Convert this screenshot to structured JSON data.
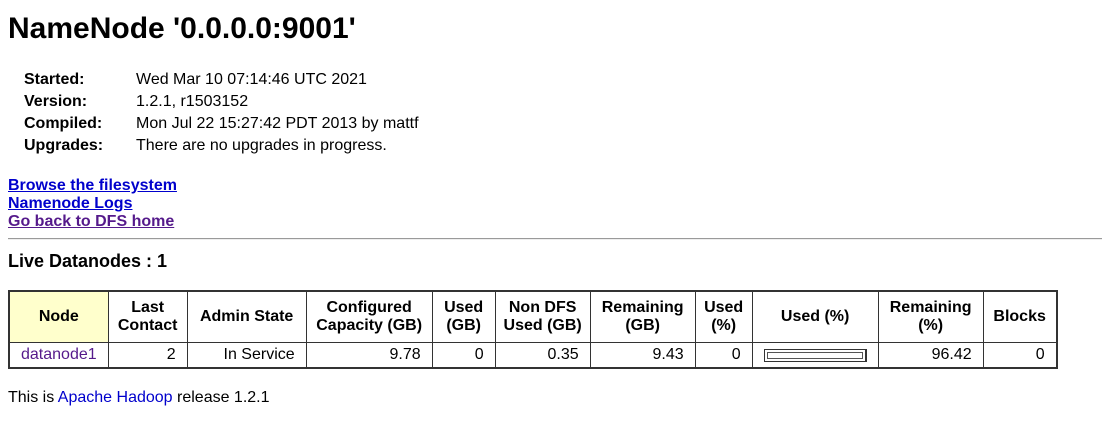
{
  "page": {
    "title": "NameNode '0.0.0.0:9001'"
  },
  "info": {
    "started_label": "Started:",
    "started_value": "Wed Mar 10 07:14:46 UTC 2021",
    "version_label": "Version:",
    "version_value": "1.2.1, r1503152",
    "compiled_label": "Compiled:",
    "compiled_value": "Mon Jul 22 15:27:42 PDT 2013 by mattf",
    "upgrades_label": "Upgrades:",
    "upgrades_value": "There are no upgrades in progress."
  },
  "links": {
    "browse": "Browse the filesystem",
    "logs": "Namenode Logs",
    "home": "Go back to DFS home"
  },
  "section": {
    "heading": "Live Datanodes : 1"
  },
  "table": {
    "headers": {
      "node": "Node",
      "last_contact": "Last Contact",
      "admin_state": "Admin State",
      "configured_capacity": "Configured Capacity (GB)",
      "used_gb": "Used (GB)",
      "non_dfs_used": "Non DFS Used (GB)",
      "remaining_gb": "Remaining (GB)",
      "used_pct": "Used (%)",
      "used_pct_bar": "Used (%)",
      "remaining_pct": "Remaining (%)",
      "blocks": "Blocks"
    },
    "rows": [
      {
        "node": "datanode1",
        "last_contact": "2",
        "admin_state": "In Service",
        "configured_capacity": "9.78",
        "used_gb": "0",
        "non_dfs_used": "0.35",
        "remaining_gb": "9.43",
        "used_pct": "0",
        "used_pct_value": 0,
        "remaining_pct": "96.42",
        "blocks": "0"
      }
    ]
  },
  "footer": {
    "prefix": "This is ",
    "link": "Apache Hadoop",
    "suffix": " release 1.2.1"
  }
}
